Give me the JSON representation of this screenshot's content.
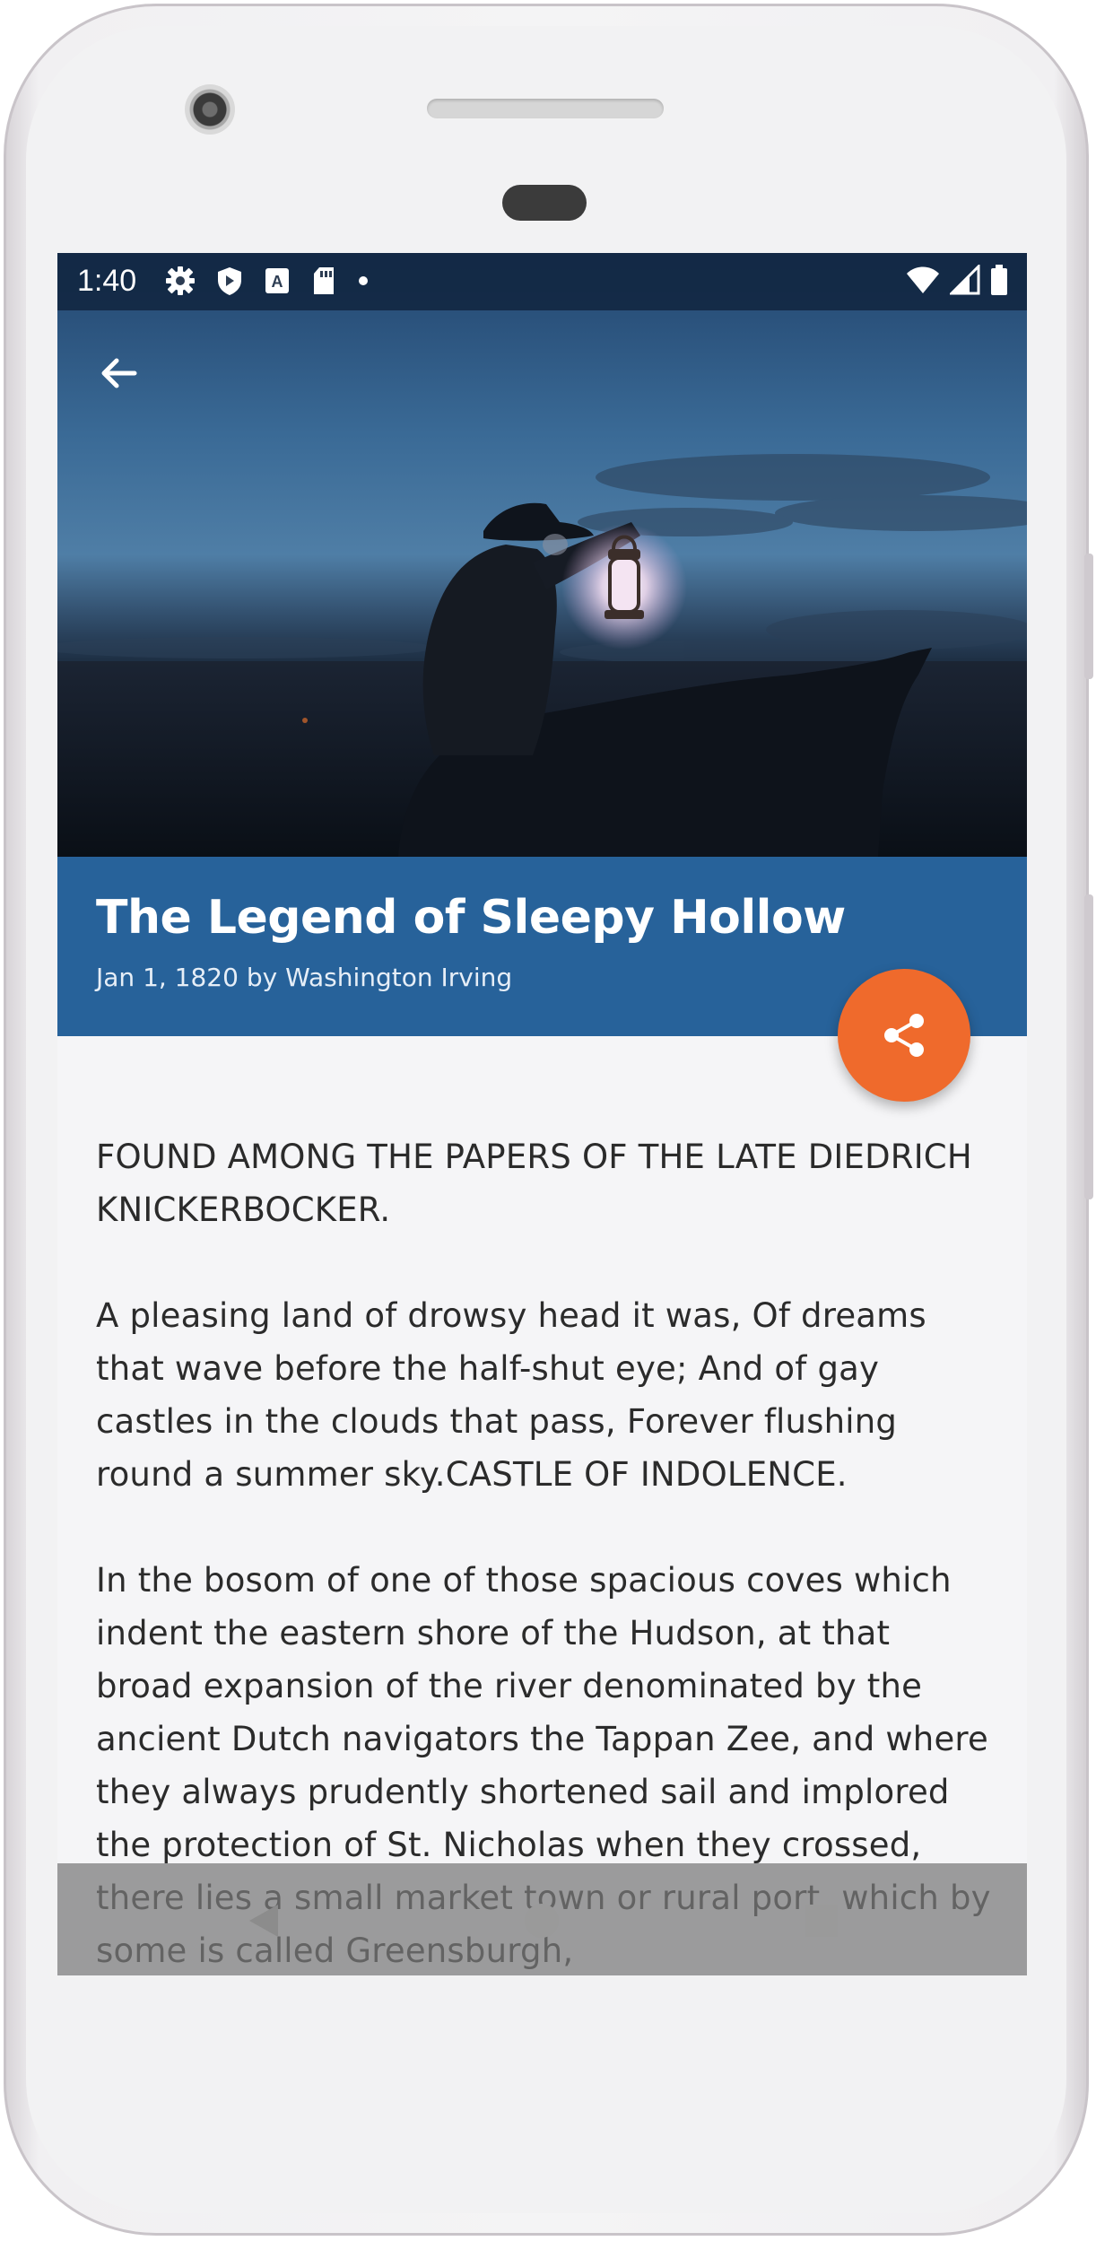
{
  "status_bar": {
    "time": "1:40",
    "left_icons": [
      "gear-icon",
      "shield-icon",
      "a-icon",
      "sd-card-icon",
      "dot-icon"
    ],
    "right_icons": [
      "wifi-icon",
      "signal-icon",
      "battery-icon"
    ]
  },
  "toolbar": {
    "back_icon": "arrow-left-icon"
  },
  "article": {
    "title": "The Legend of Sleepy Hollow",
    "meta": "Jan 1, 1820 by Washington Irving",
    "paragraphs": [
      "FOUND AMONG THE PAPERS OF THE LATE DIEDRICH KNICKERBOCKER.",
      "A pleasing land of drowsy head it was, Of dreams that wave before the half-shut eye; And of gay castles in the clouds that pass, Forever flushing round a summer sky.CASTLE OF INDOLENCE.",
      "In the bosom of one of those spacious coves which indent the eastern shore of the Hudson, at that broad expansion of the river denominated by the ancient Dutch navigators the Tappan Zee, and where they always prudently shortened sail and implored the protection of St. Nicholas when they crossed, there lies a small market town or rural port, which by some is called Greensburgh,"
    ]
  },
  "fab": {
    "icon": "share-icon",
    "color": "#ef6a2c"
  },
  "colors": {
    "title_bar": "#27629a",
    "background": "#f5f5f7"
  },
  "nav_bar": {
    "icons": [
      "back-triangle-icon",
      "home-circle-icon",
      "recents-square-icon"
    ]
  }
}
